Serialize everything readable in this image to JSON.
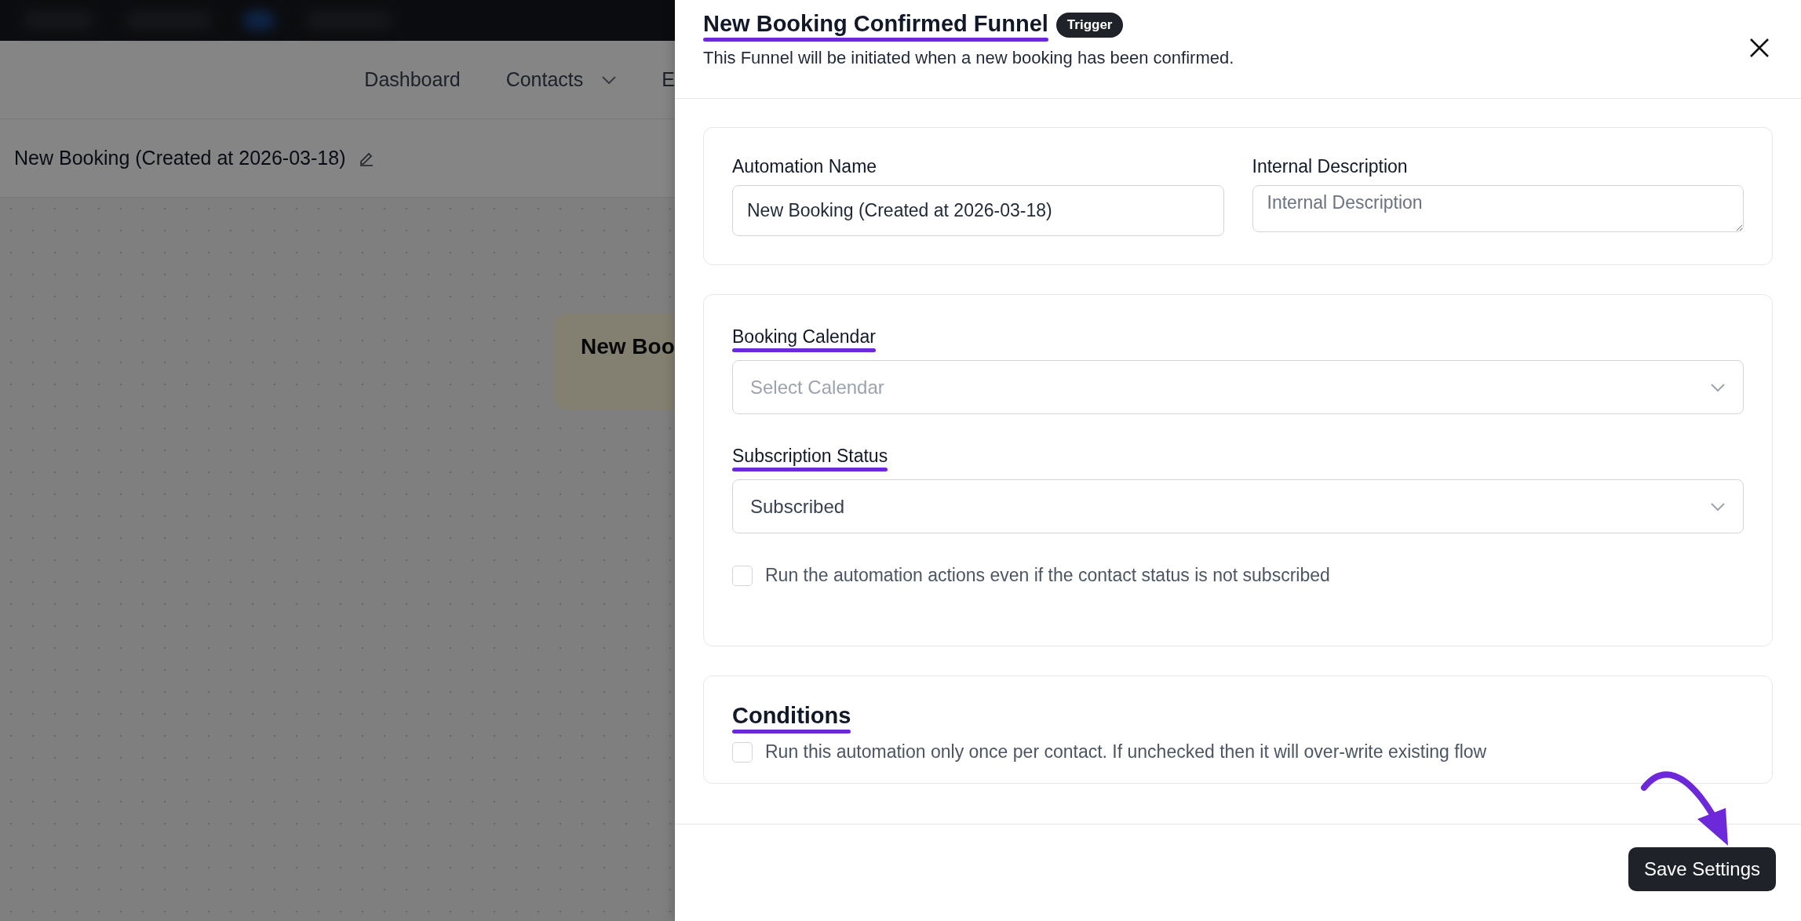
{
  "nav": [
    {
      "label": "Dashboard",
      "has_caret": false
    },
    {
      "label": "Contacts",
      "has_caret": true
    },
    {
      "label": "E",
      "has_caret": false
    }
  ],
  "page_title": "New Booking (Created at 2026-03-18)",
  "canvas_node": {
    "label": "New Boo"
  },
  "panel": {
    "title": "New Booking Confirmed Funnel",
    "title_annotated": true,
    "badge": "Trigger",
    "description": "This Funnel will be initiated when a new booking has been confirmed.",
    "general_fields": [
      {
        "kind": "input",
        "label": "Automation Name",
        "value": "New Booking (Created at 2026-03-18)"
      },
      {
        "kind": "textarea",
        "label": "Internal Description",
        "placeholder": "Internal Description"
      }
    ],
    "settings": [
      {
        "kind": "select",
        "label": "Booking Calendar",
        "placeholder": "Select Calendar",
        "annotated": true
      },
      {
        "kind": "select",
        "label": "Subscription Status",
        "value": "Subscribed",
        "annotated": true
      },
      {
        "kind": "checkbox",
        "label": "Run the automation actions even if the contact status is not subscribed",
        "checked": false
      }
    ],
    "conditions": {
      "title": "Conditions",
      "annotated": true,
      "checkbox": {
        "label": "Run this automation only once per contact. If unchecked then it will over-write existing flow",
        "checked": false
      }
    },
    "save_button": "Save Settings"
  }
}
